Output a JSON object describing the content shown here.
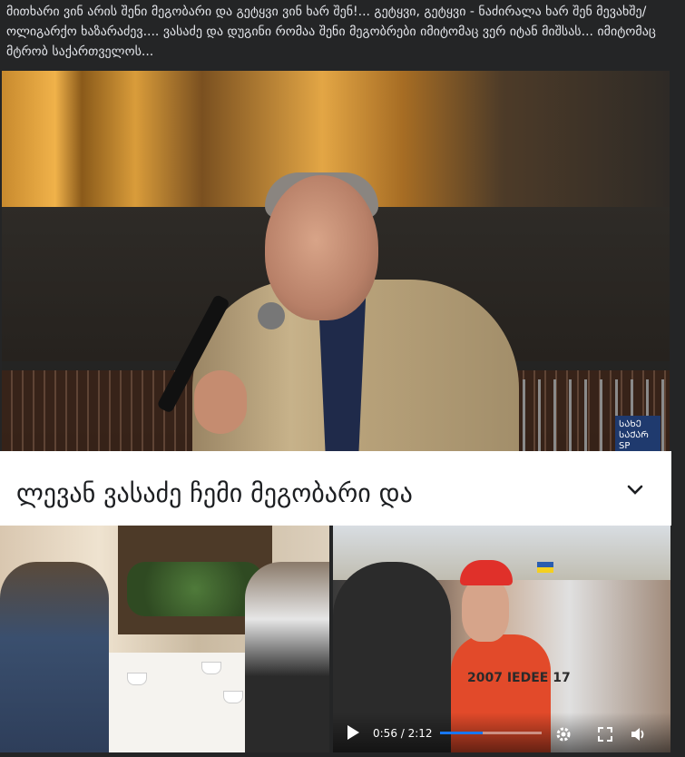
{
  "post": {
    "caption": "მითხარი ვინ არის შენი მეგობარი და გეტყვი ვინ ხარ შენ!... გეტყვი, გეტყვი - ნაძირალა ხარ შენ მევახშე/ოლიგარქო ხაზარაძევ....  ვასაძე და დუგინი რომაა შენი მეგობრები იმიტომაც ვერ იტან  მიშსას... იმიტომაც მტრობ საქართველოს...",
    "sign_text": "ᲡᲐᲮᲔ ᲡᲐᲥᲐᲠ SP PROT"
  },
  "title_card": {
    "text": "ლევან ვასაძე ჩემი მეგობარი და"
  },
  "video": {
    "time": "0:56 / 2:12",
    "progress": 0.42,
    "shirt_text": "2007 IEDEE 17"
  },
  "colors": {
    "background": "#242526",
    "caption_text": "#e4e6eb",
    "progress": "#1877f2"
  },
  "icons": {
    "expand": "chevron-down-icon",
    "play": "play-icon",
    "settings": "gear-icon",
    "fullscreen": "fullscreen-icon",
    "volume": "volume-icon"
  }
}
